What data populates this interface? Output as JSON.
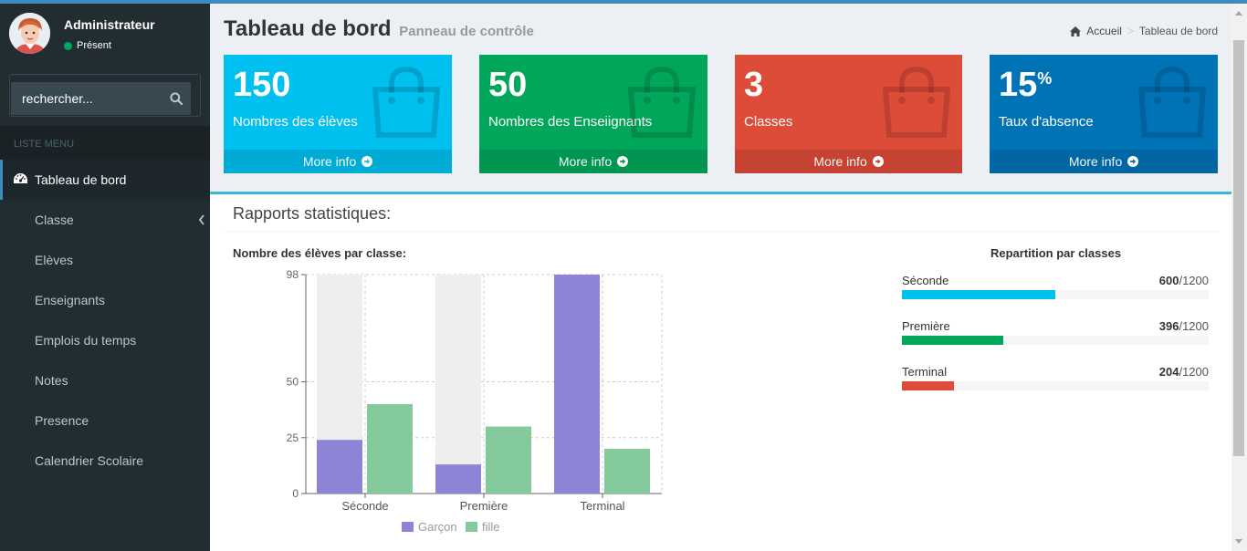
{
  "colors": {
    "aqua": "#00c0ef",
    "green": "#00a65a",
    "red": "#dd4b39",
    "blue": "#0073b7",
    "garcon": "#8b84d7",
    "fille": "#84c99c",
    "track": "#eeeeee"
  },
  "user": {
    "name": "Administrateur",
    "status": "Présent",
    "avatar_icon": "user-avatar"
  },
  "search": {
    "placeholder": "rechercher...",
    "icon": "search-icon"
  },
  "sidebar": {
    "header": "LISTE MENU",
    "items": [
      {
        "label": "Tableau de bord",
        "icon": "dashboard-icon",
        "active": true
      },
      {
        "label": "Classe",
        "has_children": true
      },
      {
        "label": "Elèves"
      },
      {
        "label": "Enseignants"
      },
      {
        "label": "Emplois du temps"
      },
      {
        "label": "Notes"
      },
      {
        "label": "Presence"
      },
      {
        "label": "Calendrier Scolaire"
      }
    ]
  },
  "header": {
    "title": "Tableau de bord",
    "subtitle": "Panneau de contrôle"
  },
  "breadcrumb": {
    "home": "Accueil",
    "current": "Tableau de bord",
    "home_icon": "home-icon"
  },
  "boxes": [
    {
      "value": "150",
      "label": "Nombres des élèves",
      "link": "More info",
      "color": "aqua",
      "icon": "shopping-bag-icon"
    },
    {
      "value": "50",
      "label": "Nombres des Enseiignants",
      "link": "More info",
      "color": "green",
      "icon": "shopping-bag-icon"
    },
    {
      "value": "3",
      "label": "Classes",
      "link": "More info",
      "color": "red",
      "icon": "shopping-bag-icon"
    },
    {
      "value": "15",
      "suffix": "%",
      "label": "Taux d'absence",
      "link": "More info",
      "color": "blue",
      "icon": "shopping-bag-icon"
    }
  ],
  "reports": {
    "title": "Rapports statistiques:"
  },
  "chart_data": {
    "type": "bar",
    "title": "Nombre des élèves par classe:",
    "categories": [
      "Séconde",
      "Première",
      "Terminal"
    ],
    "series": [
      {
        "name": "Garçon",
        "values": [
          24,
          13,
          98
        ]
      },
      {
        "name": "fille",
        "values": [
          40,
          30,
          20
        ]
      }
    ],
    "ylim": [
      0,
      98
    ],
    "yticks": [
      0,
      25,
      50,
      98
    ],
    "grid": true,
    "legend": "bottom"
  },
  "repartition": {
    "title": "Repartition par classes",
    "items": [
      {
        "label": "Séconde",
        "value": 600,
        "total": "/1200",
        "color": "aqua"
      },
      {
        "label": "Première",
        "value": 396,
        "total": "/1200",
        "color": "green"
      },
      {
        "label": "Terminal",
        "value": 204,
        "total": "/1200",
        "color": "red"
      }
    ],
    "max": 1200
  }
}
